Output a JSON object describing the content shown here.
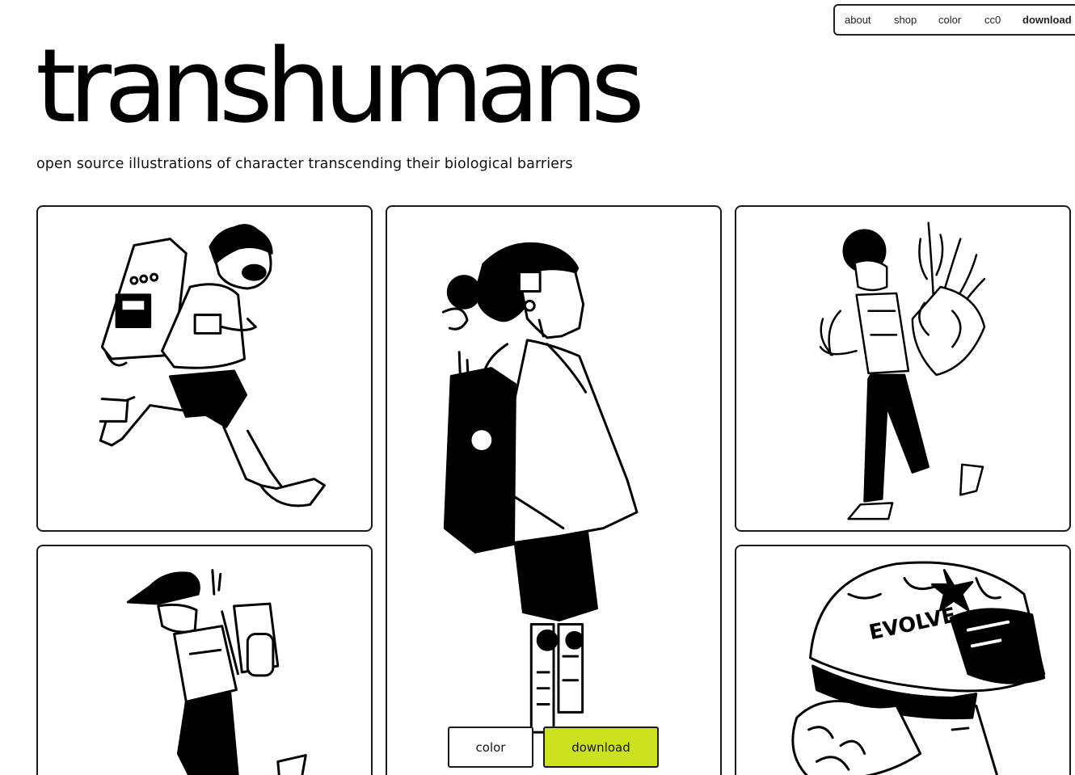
{
  "nav": {
    "items": [
      {
        "label": "about",
        "bold": false
      },
      {
        "label": "shop",
        "bold": false
      },
      {
        "label": "color",
        "bold": false
      },
      {
        "label": "cc0",
        "bold": false
      },
      {
        "label": "download",
        "bold": true
      }
    ]
  },
  "header": {
    "title": "transhumans",
    "subtitle": "open source illustrations of character transcending their biological barriers"
  },
  "gallery": {
    "cards": [
      {
        "subject": "running character with electronic backpack"
      },
      {
        "subject": "character with robotic leg and tech backpack"
      },
      {
        "subject": "character carrying plant backpack"
      },
      {
        "subject": "character in cap with gas tank backpack"
      },
      {
        "subject": "character in helmet with goggles",
        "helmet_text": "EVOLVE"
      }
    ]
  },
  "actions": {
    "color_label": "color",
    "download_label": "download",
    "accent": "#cde21f"
  }
}
